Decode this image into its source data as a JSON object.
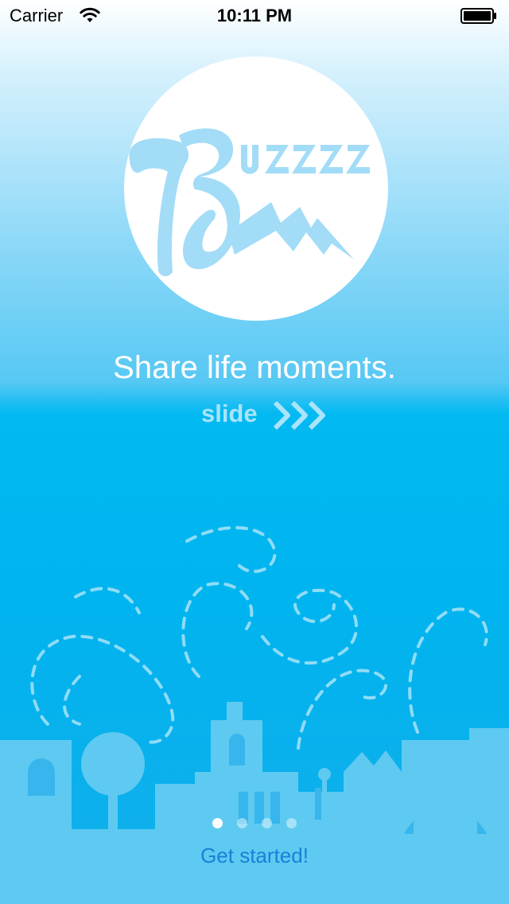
{
  "status_bar": {
    "carrier": "Carrier",
    "time": "10:11 PM",
    "wifi_icon": "wifi-icon",
    "battery_icon": "battery-icon"
  },
  "logo": {
    "icon": "buzzz-logo",
    "wordmark": "Buzzz"
  },
  "tagline": "Share life moments.",
  "slide_hint": {
    "label": "slide",
    "icon": "triple-chevron-right-icon"
  },
  "illustration": {
    "icon": "city-skyline-illustration"
  },
  "pager": {
    "count": 4,
    "active_index": 0
  },
  "get_started_label": "Get started!",
  "colors": {
    "background_top": "#ffffff",
    "background_bottom": "#00b4ef",
    "accent_button": "#1a7fd9",
    "logo_blue": "#a2dcf7",
    "city_light": "#5ecaf1"
  }
}
